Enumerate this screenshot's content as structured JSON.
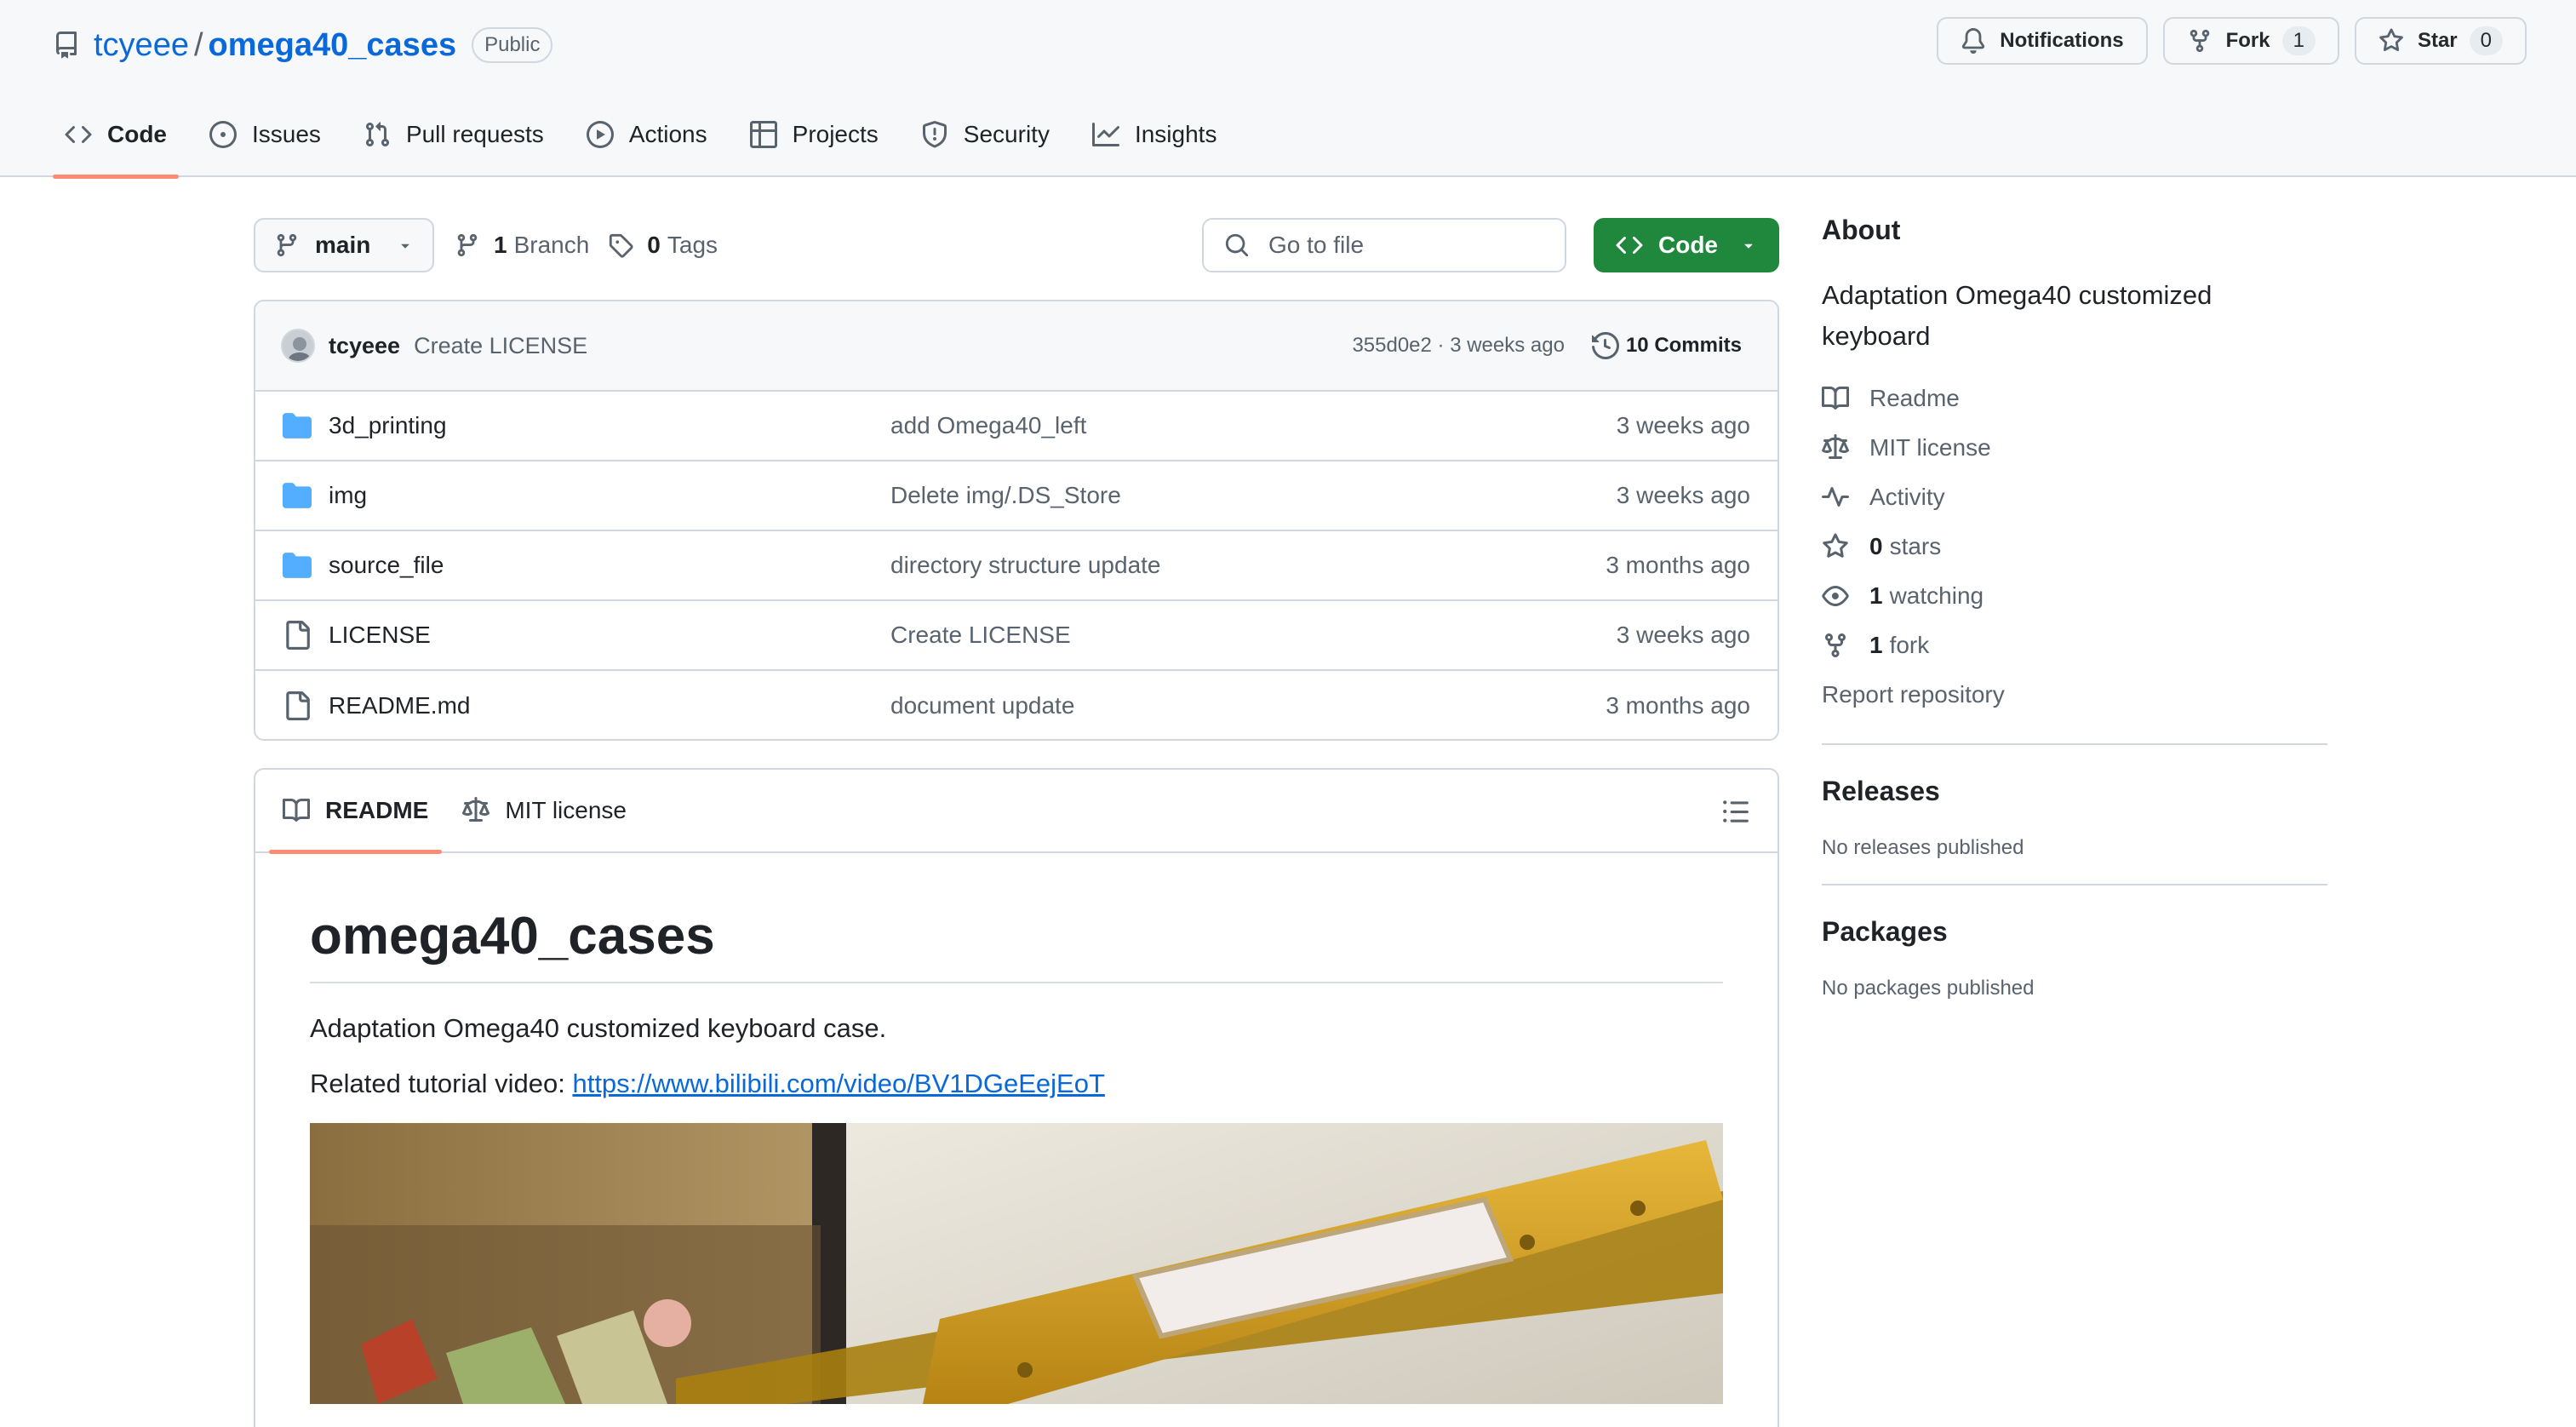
{
  "repo": {
    "owner": "tcyeee",
    "separator": "/",
    "name": "omega40_cases",
    "visibility": "Public"
  },
  "header_actions": {
    "notifications": "Notifications",
    "fork_label": "Fork",
    "fork_count": "1",
    "star_label": "Star",
    "star_count": "0"
  },
  "nav": [
    {
      "label": "Code",
      "icon": "code-icon",
      "selected": true
    },
    {
      "label": "Issues",
      "icon": "issue-icon"
    },
    {
      "label": "Pull requests",
      "icon": "pull-request-icon"
    },
    {
      "label": "Actions",
      "icon": "play-icon"
    },
    {
      "label": "Projects",
      "icon": "table-icon"
    },
    {
      "label": "Security",
      "icon": "shield-icon"
    },
    {
      "label": "Insights",
      "icon": "graph-icon"
    }
  ],
  "toolbar": {
    "branch": "main",
    "branches_count": "1",
    "branches_label": "Branch",
    "tags_count": "0",
    "tags_label": "Tags",
    "goto_placeholder": "Go to file",
    "code_button": "Code"
  },
  "latest_commit": {
    "author": "tcyeee",
    "message": "Create LICENSE",
    "sha_time": "355d0e2 · 3 weeks ago",
    "commits": "10 Commits"
  },
  "files": [
    {
      "type": "folder",
      "name": "3d_printing",
      "message": "add Omega40_left",
      "date": "3 weeks ago"
    },
    {
      "type": "folder",
      "name": "img",
      "message": "Delete img/.DS_Store",
      "date": "3 weeks ago"
    },
    {
      "type": "folder",
      "name": "source_file",
      "message": "directory structure update",
      "date": "3 months ago"
    },
    {
      "type": "file",
      "name": "LICENSE",
      "message": "Create LICENSE",
      "date": "3 weeks ago"
    },
    {
      "type": "file",
      "name": "README.md",
      "message": "document update",
      "date": "3 months ago"
    }
  ],
  "readme": {
    "tab_readme": "README",
    "tab_license": "MIT license",
    "title": "omega40_cases",
    "paragraph": "Adaptation Omega40 customized keyboard case.",
    "video_prefix": "Related tutorial video: ",
    "video_link": "https://www.bilibili.com/video/BV1DGeEejEoT"
  },
  "about": {
    "heading": "About",
    "description": "Adaptation Omega40 customized keyboard",
    "readme": "Readme",
    "license": "MIT license",
    "activity": "Activity",
    "stars_count": "0",
    "stars_label": "stars",
    "watching_count": "1",
    "watching_label": "watching",
    "forks_count": "1",
    "forks_label": "fork",
    "report": "Report repository"
  },
  "releases": {
    "heading": "Releases",
    "note": "No releases published"
  },
  "packages": {
    "heading": "Packages",
    "note": "No packages published"
  },
  "colors": {
    "accent": "#0969da",
    "primary_button": "#1f883d",
    "tab_underline": "#fd8c73",
    "folder": "#54aeff"
  }
}
